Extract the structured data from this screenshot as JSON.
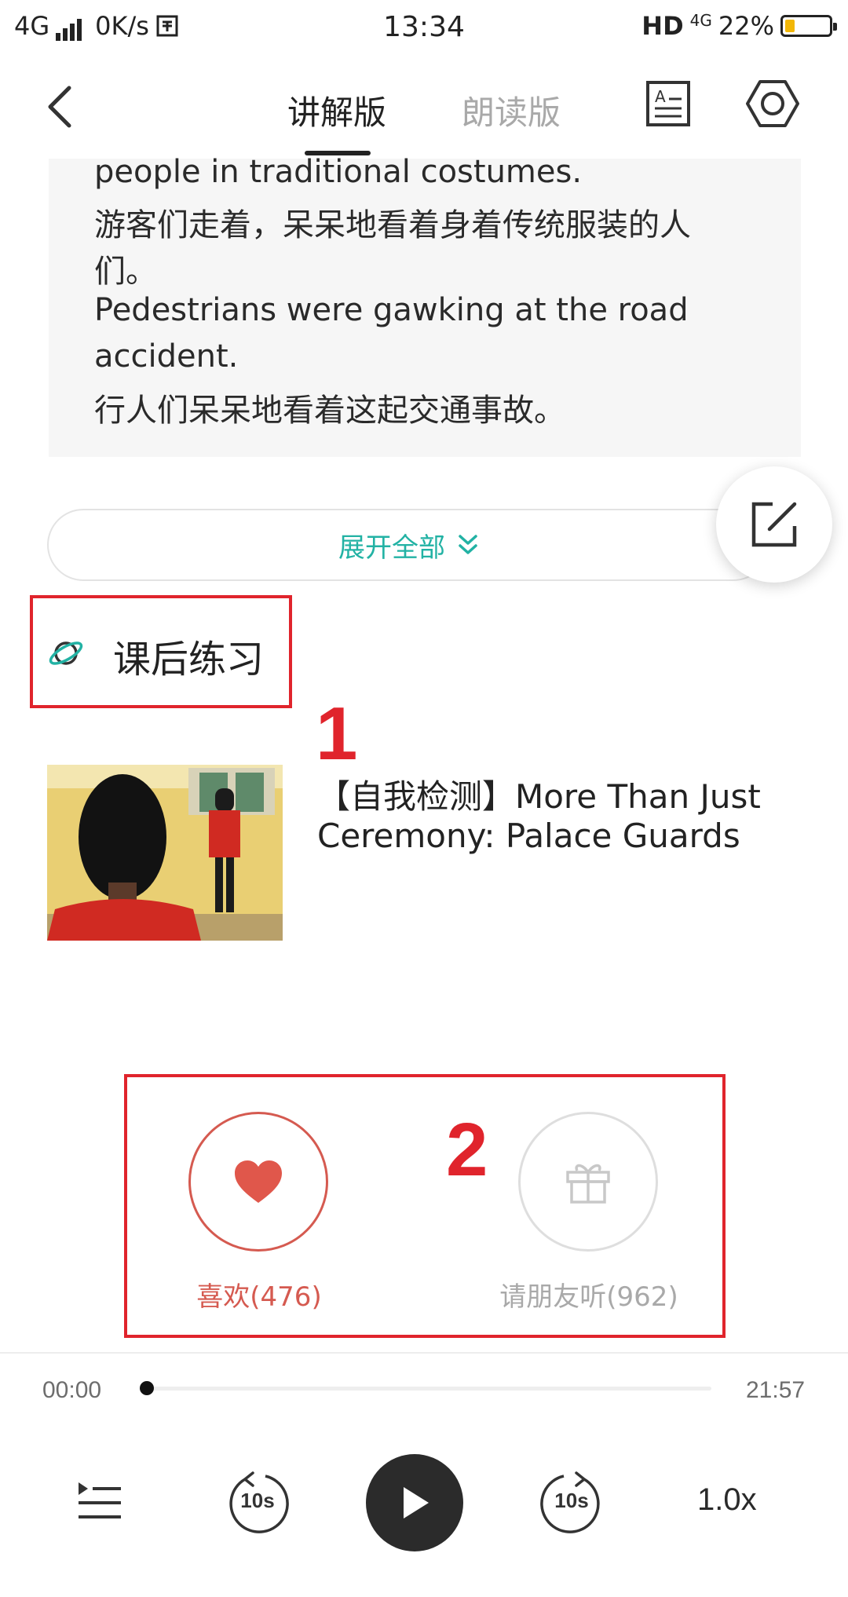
{
  "status_bar": {
    "network": "4G",
    "speed": "0K/s",
    "time": "13:34",
    "hd": "HD",
    "net2": "4G",
    "battery": "22%",
    "battery_level": 0.22
  },
  "nav": {
    "tabs": [
      {
        "label": "讲解版",
        "active": true
      },
      {
        "label": "朗读版",
        "active": false
      }
    ]
  },
  "content": {
    "lines": [
      "people in traditional costumes.",
      "游客们走着，呆呆地看着身着传统服装的人",
      "们。",
      "Pedestrians were gawking at the road",
      "accident.",
      "行人们呆呆地看着这起交通事故。"
    ],
    "expand_label": "展开全部"
  },
  "annotations": {
    "label1": "1",
    "label2": "2"
  },
  "exercise": {
    "section_title": "课后练习",
    "lesson_title": "【自我检测】More Than Just Ceremony: Palace Guards"
  },
  "actions": {
    "like_label": "喜欢(476)",
    "share_label": "请朋友听(962)"
  },
  "player": {
    "current_time": "00:00",
    "total_time": "21:57",
    "progress": 0,
    "rewind_label": "10s",
    "forward_label": "10s",
    "speed_label": "1.0x"
  },
  "colors": {
    "accent_teal": "#22b2a4",
    "like_red": "#d55a50",
    "annotation_red": "#e0242c"
  }
}
